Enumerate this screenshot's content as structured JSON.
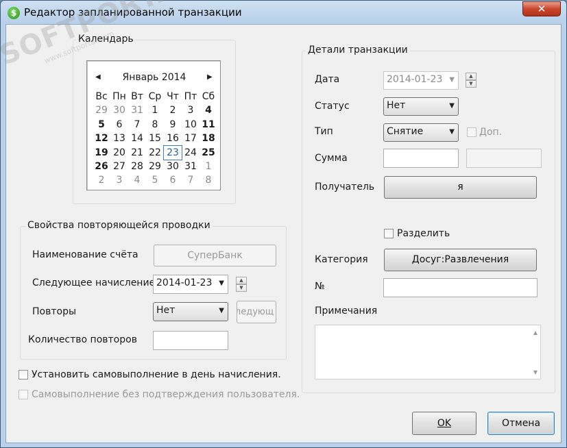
{
  "window": {
    "title": "Редактор запланированной транзакции",
    "close_label": "✕"
  },
  "watermark": {
    "text": "SOFTPORTAL",
    "url": "www.softportal.com"
  },
  "calendar": {
    "group_label": "Календарь",
    "month_title": "Январь 2014",
    "weekdays": [
      "Вс",
      "Пн",
      "Вт",
      "Ср",
      "Чт",
      "Пт",
      "Сб"
    ],
    "weeks": [
      [
        "29",
        "30",
        "31",
        "1",
        "2",
        "3",
        "4"
      ],
      [
        "5",
        "6",
        "7",
        "8",
        "9",
        "10",
        "11"
      ],
      [
        "12",
        "13",
        "14",
        "15",
        "16",
        "17",
        "18"
      ],
      [
        "19",
        "20",
        "21",
        "22",
        "23",
        "24",
        "25"
      ],
      [
        "26",
        "27",
        "28",
        "29",
        "30",
        "31",
        "1"
      ],
      [
        "2",
        "3",
        "4",
        "5",
        "6",
        "7",
        "8"
      ]
    ],
    "selected_day": "23"
  },
  "recurrence": {
    "group_label": "Свойства повторяющейся проводки",
    "account_label": "Наименование счёта",
    "account_value": "СуперБанк",
    "next_label": "Следующее начисление",
    "next_value": "2014-01-23",
    "repeat_label": "Повторы",
    "repeat_value": "Нет",
    "repeat_button": "ледующ",
    "count_label": "Количество повторов",
    "count_value": ""
  },
  "options": {
    "auto_execute": "Установить самовыполнение в день начисления.",
    "auto_confirm": "Самовыполнение без подтверждения пользователя."
  },
  "details": {
    "group_label": "Детали транзакции",
    "date_label": "Дата",
    "date_value": "2014-01-23",
    "status_label": "Статус",
    "status_value": "Нет",
    "type_label": "Тип",
    "type_value": "Снятие",
    "extra_label": "Доп.",
    "amount_label": "Сумма",
    "amount_value": "",
    "payee_label": "Получатель",
    "payee_value": "я",
    "split_label": "Разделить",
    "category_label": "Категория",
    "category_value": "Досуг:Развлечения",
    "number_label": "№",
    "number_value": "",
    "notes_label": "Примечания"
  },
  "buttons": {
    "ok": "OK",
    "cancel": "Отмена"
  }
}
